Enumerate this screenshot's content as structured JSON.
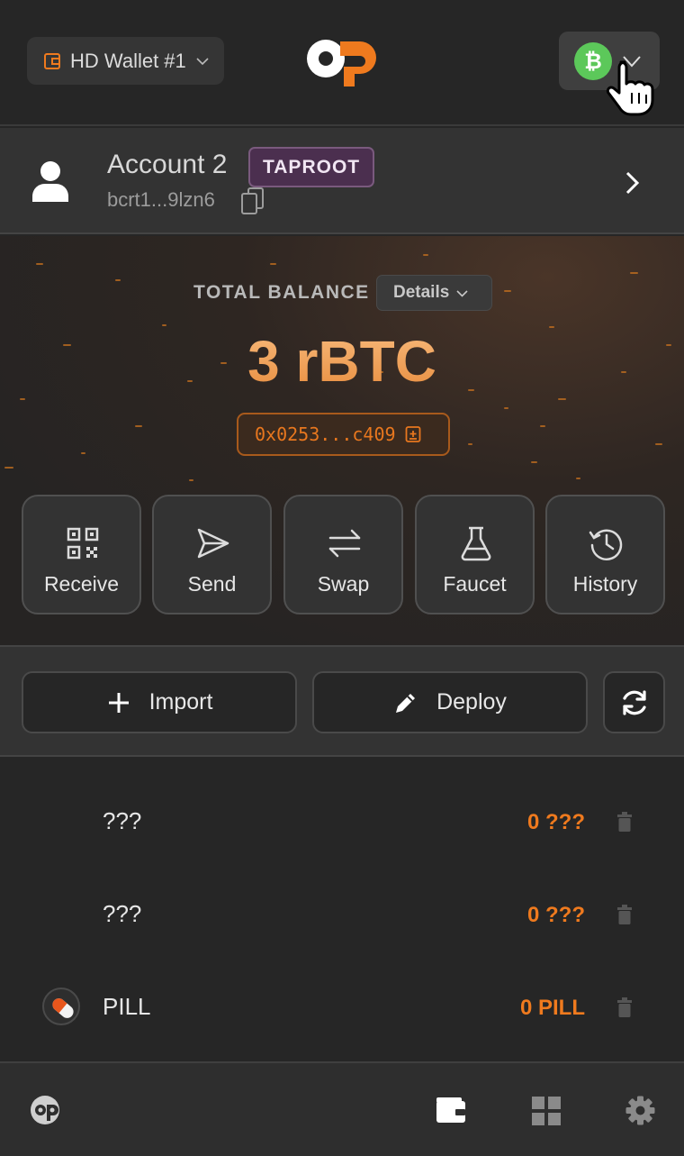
{
  "header": {
    "wallet_label": "HD Wallet #1",
    "network_icon": "bitcoin-icon",
    "network_color": "#5cc85a"
  },
  "account": {
    "name": "Account 2",
    "badge": "TAPROOT",
    "address": "bcrt1...9lzn6"
  },
  "balance": {
    "label": "TOTAL BALANCE",
    "details_label": "Details",
    "amount": "3 rBTC",
    "address": "0x0253...c409"
  },
  "actions": [
    {
      "label": "Receive",
      "icon": "qr-code-icon"
    },
    {
      "label": "Send",
      "icon": "send-icon"
    },
    {
      "label": "Swap",
      "icon": "swap-icon"
    },
    {
      "label": "Faucet",
      "icon": "flask-icon"
    },
    {
      "label": "History",
      "icon": "history-icon"
    }
  ],
  "toolbar": {
    "import_label": "Import",
    "deploy_label": "Deploy"
  },
  "tokens": [
    {
      "name": "???",
      "amount": "0 ???"
    },
    {
      "name": "???",
      "amount": "0 ???"
    },
    {
      "name": "PILL",
      "amount": "0 PILL",
      "icon": "pill-icon"
    }
  ],
  "colors": {
    "accent": "#ef7a1e",
    "background": "#262626",
    "taproot_badge": "#4b2f4f"
  }
}
